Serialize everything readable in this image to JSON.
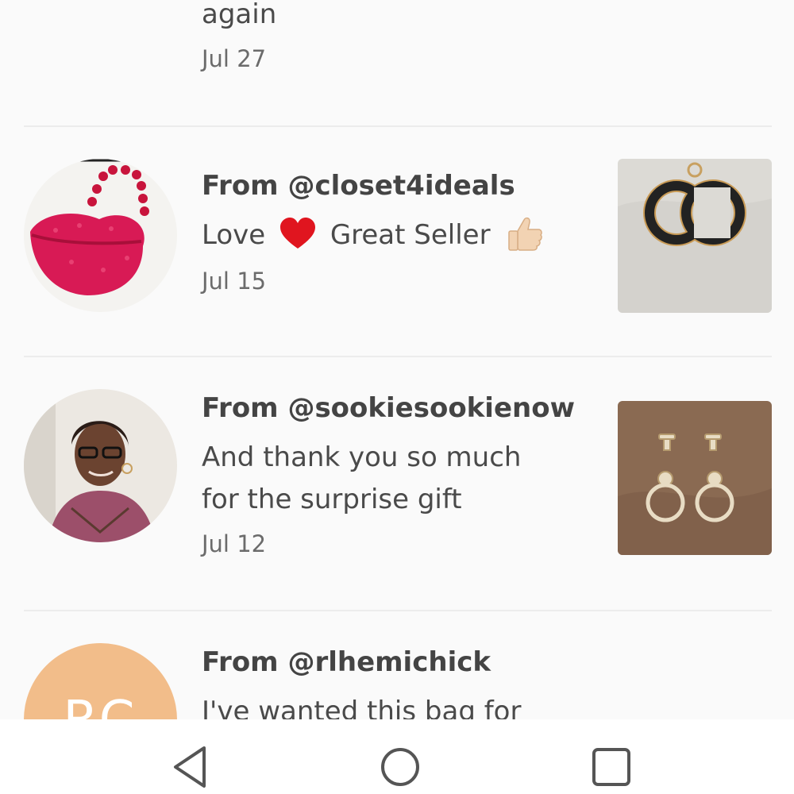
{
  "reviews": [
    {
      "text": "again",
      "date": "Jul 27"
    },
    {
      "from": "From @closet4ideals",
      "text_before_heart": "Love",
      "text_after_heart": "Great Seller",
      "heart_icon": "red-heart-emoji",
      "thumb_icon": "thumbs-up-emoji",
      "date": "Jul 15",
      "avatar": "red-sequin-lips-purse",
      "thumbnail": "black-cc-logo-charm"
    },
    {
      "from": "From @sookiesookienow",
      "text_line1": "And thank you so much",
      "text_line2": "for the surprise gift",
      "date": "Jul 12",
      "avatar": "woman-portrait",
      "thumbnail": "gold-ring-turnlock-hardware"
    },
    {
      "from": "From @rlhemichick",
      "text": "I've wanted this bag for",
      "avatar_initials": "RC",
      "avatar_color": "#f2bd8a"
    }
  ],
  "navbar": {
    "back": "back-triangle-icon",
    "home": "home-circle-icon",
    "recents": "recents-square-icon"
  }
}
